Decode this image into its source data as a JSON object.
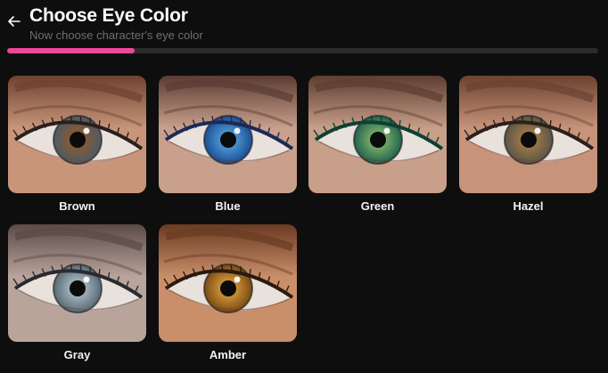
{
  "header": {
    "title": "Choose Eye Color",
    "subtitle": "Now choose character's eye color",
    "back_icon": "arrow-left-icon"
  },
  "progress": {
    "fraction": 0.215,
    "color": "#ec4899"
  },
  "options": [
    {
      "label": "Brown",
      "skin": "#c8957b",
      "skin_dark": "#6e4231",
      "iris_outer": "#4d5a66",
      "iris_inner": "#8a5a30",
      "lash": "#2a1f1a"
    },
    {
      "label": "Blue",
      "skin": "#c9a08c",
      "skin_dark": "#5a3c33",
      "iris_outer": "#1c4f93",
      "iris_inner": "#4f9ad8",
      "lash": "#1c2a55"
    },
    {
      "label": "Green",
      "skin": "#c89f88",
      "skin_dark": "#5c3d31",
      "iris_outer": "#23624e",
      "iris_inner": "#7bb26a",
      "lash": "#0f3f35"
    },
    {
      "label": "Hazel",
      "skin": "#c7937a",
      "skin_dark": "#6c4230",
      "iris_outer": "#5b5548",
      "iris_inner": "#a07a48",
      "lash": "#2b211b"
    },
    {
      "label": "Gray",
      "skin": "#b9a49c",
      "skin_dark": "#5a4a46",
      "iris_outer": "#5a6a75",
      "iris_inner": "#a8b8c2",
      "lash": "#2a2a30"
    },
    {
      "label": "Amber",
      "skin": "#c98f6a",
      "skin_dark": "#6a3a22",
      "iris_outer": "#7a4a14",
      "iris_inner": "#d49a3a",
      "lash": "#2a1a10"
    }
  ]
}
